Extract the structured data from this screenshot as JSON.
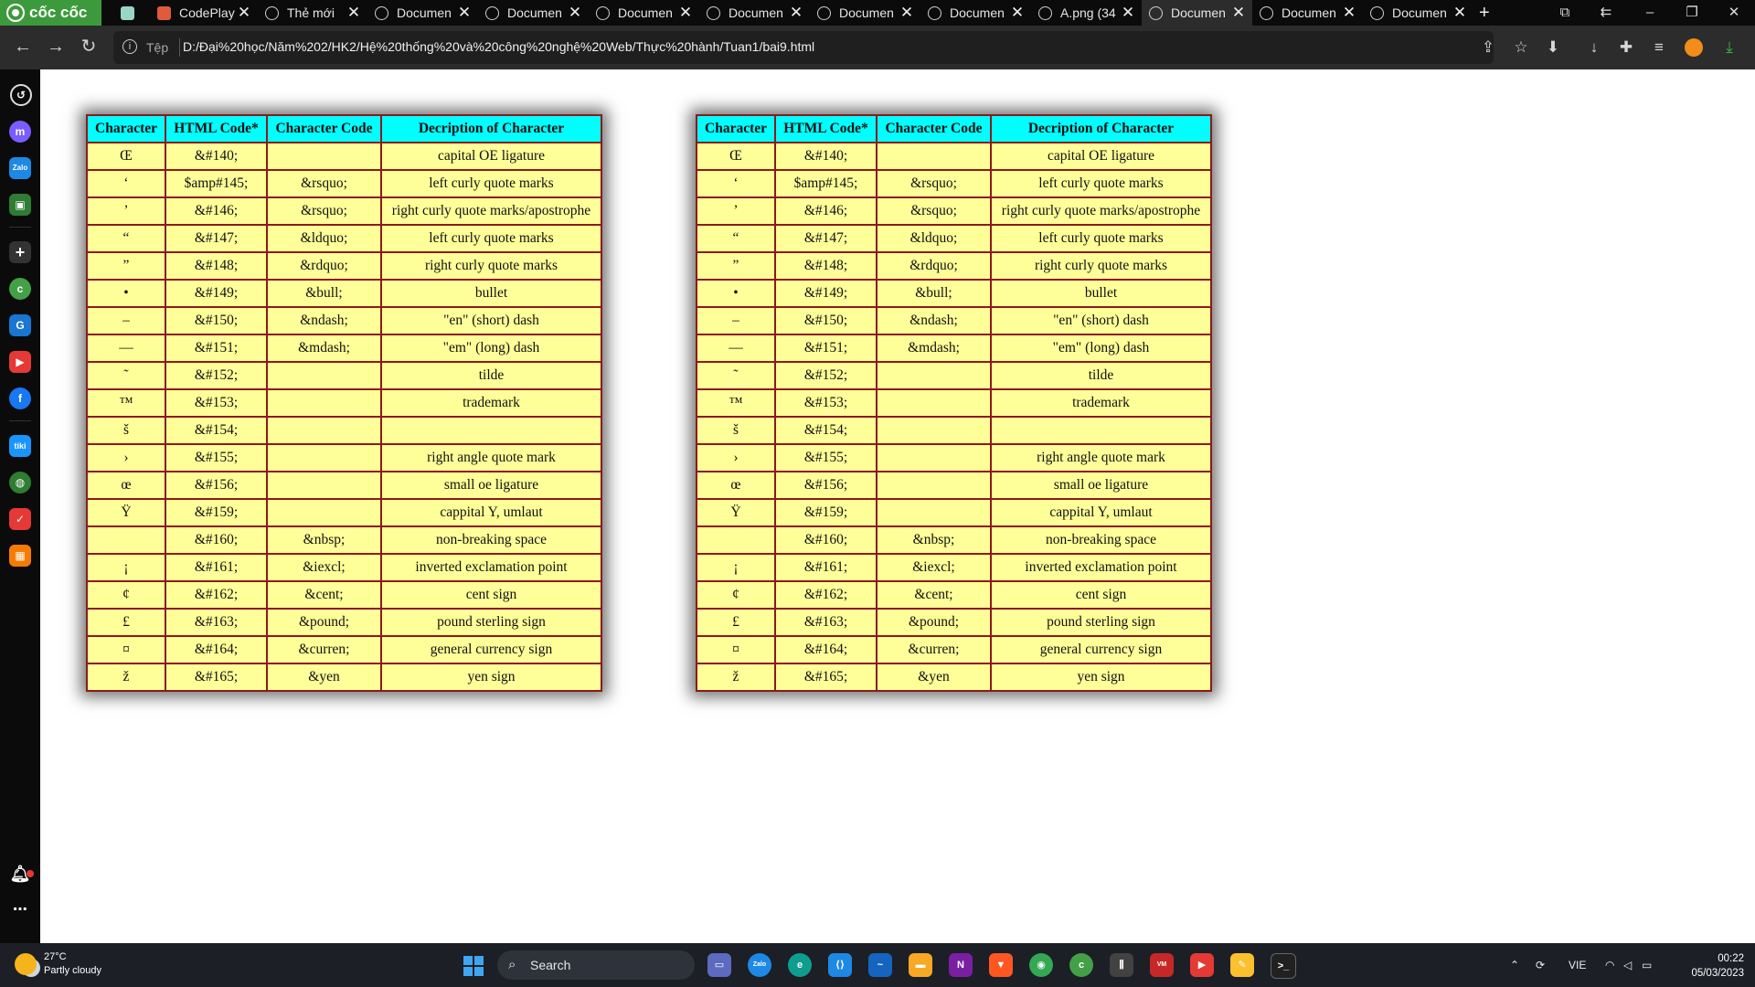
{
  "browser": {
    "brand": "cốc cốc",
    "tabs": [
      {
        "title": "",
        "icon": "chatgpt-icon",
        "active": false,
        "closable": false
      },
      {
        "title": "CodePlay",
        "icon": "figma-icon",
        "active": false,
        "closable": true
      },
      {
        "title": "Thẻ mới",
        "icon": "coccoc-icon",
        "active": false,
        "closable": true
      },
      {
        "title": "Documen",
        "icon": "globe-icon",
        "active": false,
        "closable": true
      },
      {
        "title": "Documen",
        "icon": "globe-icon",
        "active": false,
        "closable": true
      },
      {
        "title": "Documen",
        "icon": "globe-icon",
        "active": false,
        "closable": true
      },
      {
        "title": "Documen",
        "icon": "globe-icon",
        "active": false,
        "closable": true
      },
      {
        "title": "Documen",
        "icon": "globe-icon",
        "active": false,
        "closable": true
      },
      {
        "title": "Documen",
        "icon": "globe-icon",
        "active": false,
        "closable": true
      },
      {
        "title": "A.png (34",
        "icon": "globe-icon",
        "active": false,
        "closable": true
      },
      {
        "title": "Documen",
        "icon": "globe-icon",
        "active": true,
        "closable": true
      },
      {
        "title": "Documen",
        "icon": "globe-icon",
        "active": false,
        "closable": true
      },
      {
        "title": "Documen",
        "icon": "globe-icon",
        "active": false,
        "closable": true
      }
    ],
    "address": {
      "scheme_label": "Tệp",
      "url": "D:/Đại%20học/Năm%202/HK2/Hệ%20thống%20và%20công%20nghệ%20Web/Thực%20hành/Tuan1/bai9.html"
    }
  },
  "page": {
    "tables": [
      {
        "headers": [
          "Character",
          "HTML Code*",
          "Character Code",
          "Decription of Character"
        ],
        "rows": [
          [
            "Œ",
            "&#140;",
            "",
            "capital OE ligature"
          ],
          [
            "‘",
            "$amp#145;",
            "&rsquo;",
            "left curly quote marks"
          ],
          [
            "’",
            "&#146;",
            "&rsquo;",
            "right curly quote marks/apostrophe"
          ],
          [
            "“",
            "&#147;",
            "&ldquo;",
            "left curly quote marks"
          ],
          [
            "”",
            "&#148;",
            "&rdquo;",
            "right curly quote marks"
          ],
          [
            "•",
            "&#149;",
            "&bull;",
            "bullet"
          ],
          [
            "–",
            "&#150;",
            "&ndash;",
            "\"en\" (short) dash"
          ],
          [
            "—",
            "&#151;",
            "&mdash;",
            "\"em\" (long) dash"
          ],
          [
            "˜",
            "&#152;",
            "",
            "tilde"
          ],
          [
            "™",
            "&#153;",
            "",
            "trademark"
          ],
          [
            "š",
            "&#154;",
            "",
            ""
          ],
          [
            "›",
            "&#155;",
            "",
            "right angle quote mark"
          ],
          [
            "œ",
            "&#156;",
            "",
            "small oe ligature"
          ],
          [
            "Ÿ",
            "&#159;",
            "",
            "cappital Y, umlaut"
          ],
          [
            "",
            "&#160;",
            "&nbsp;",
            "non-breaking space"
          ],
          [
            "¡",
            "&#161;",
            "&iexcl;",
            "inverted exclamation point"
          ],
          [
            "¢",
            "&#162;",
            "&cent;",
            "cent sign"
          ],
          [
            "£",
            "&#163;",
            "&pound;",
            "pound sterling sign"
          ],
          [
            "¤",
            "&#164;",
            "&curren;",
            "general currency sign"
          ],
          [
            "ž",
            "&#165;",
            "&yen",
            "yen sign"
          ]
        ]
      },
      {
        "headers": [
          "Character",
          "HTML Code*",
          "Character Code",
          "Decription of Character"
        ],
        "rows": [
          [
            "Œ",
            "&#140;",
            "",
            "capital OE ligature"
          ],
          [
            "‘",
            "$amp#145;",
            "&rsquo;",
            "left curly quote marks"
          ],
          [
            "’",
            "&#146;",
            "&rsquo;",
            "right curly quote marks/apostrophe"
          ],
          [
            "“",
            "&#147;",
            "&ldquo;",
            "left curly quote marks"
          ],
          [
            "”",
            "&#148;",
            "&rdquo;",
            "right curly quote marks"
          ],
          [
            "•",
            "&#149;",
            "&bull;",
            "bullet"
          ],
          [
            "–",
            "&#150;",
            "&ndash;",
            "\"en\" (short) dash"
          ],
          [
            "—",
            "&#151;",
            "&mdash;",
            "\"em\" (long) dash"
          ],
          [
            "˜",
            "&#152;",
            "",
            "tilde"
          ],
          [
            "™",
            "&#153;",
            "",
            "trademark"
          ],
          [
            "š",
            "&#154;",
            "",
            ""
          ],
          [
            "›",
            "&#155;",
            "",
            "right angle quote mark"
          ],
          [
            "œ",
            "&#156;",
            "",
            "small oe ligature"
          ],
          [
            "Ÿ",
            "&#159;",
            "",
            "cappital Y, umlaut"
          ],
          [
            "",
            "&#160;",
            "&nbsp;",
            "non-breaking space"
          ],
          [
            "¡",
            "&#161;",
            "&iexcl;",
            "inverted exclamation point"
          ],
          [
            "¢",
            "&#162;",
            "&cent;",
            "cent sign"
          ],
          [
            "£",
            "&#163;",
            "&pound;",
            "pound sterling sign"
          ],
          [
            "¤",
            "&#164;",
            "&curren;",
            "general currency sign"
          ],
          [
            "ž",
            "&#165;",
            "&yen",
            "yen sign"
          ]
        ]
      }
    ],
    "colors": {
      "header_bg": "#00ffff",
      "cell_bg": "#ffff99",
      "border": "#8b1a1a"
    }
  },
  "taskbar": {
    "weather_temp": "27°C",
    "weather_desc": "Partly cloudy",
    "search_label": "Search",
    "language": "VIE",
    "time": "00:22",
    "date": "05/03/2023"
  }
}
